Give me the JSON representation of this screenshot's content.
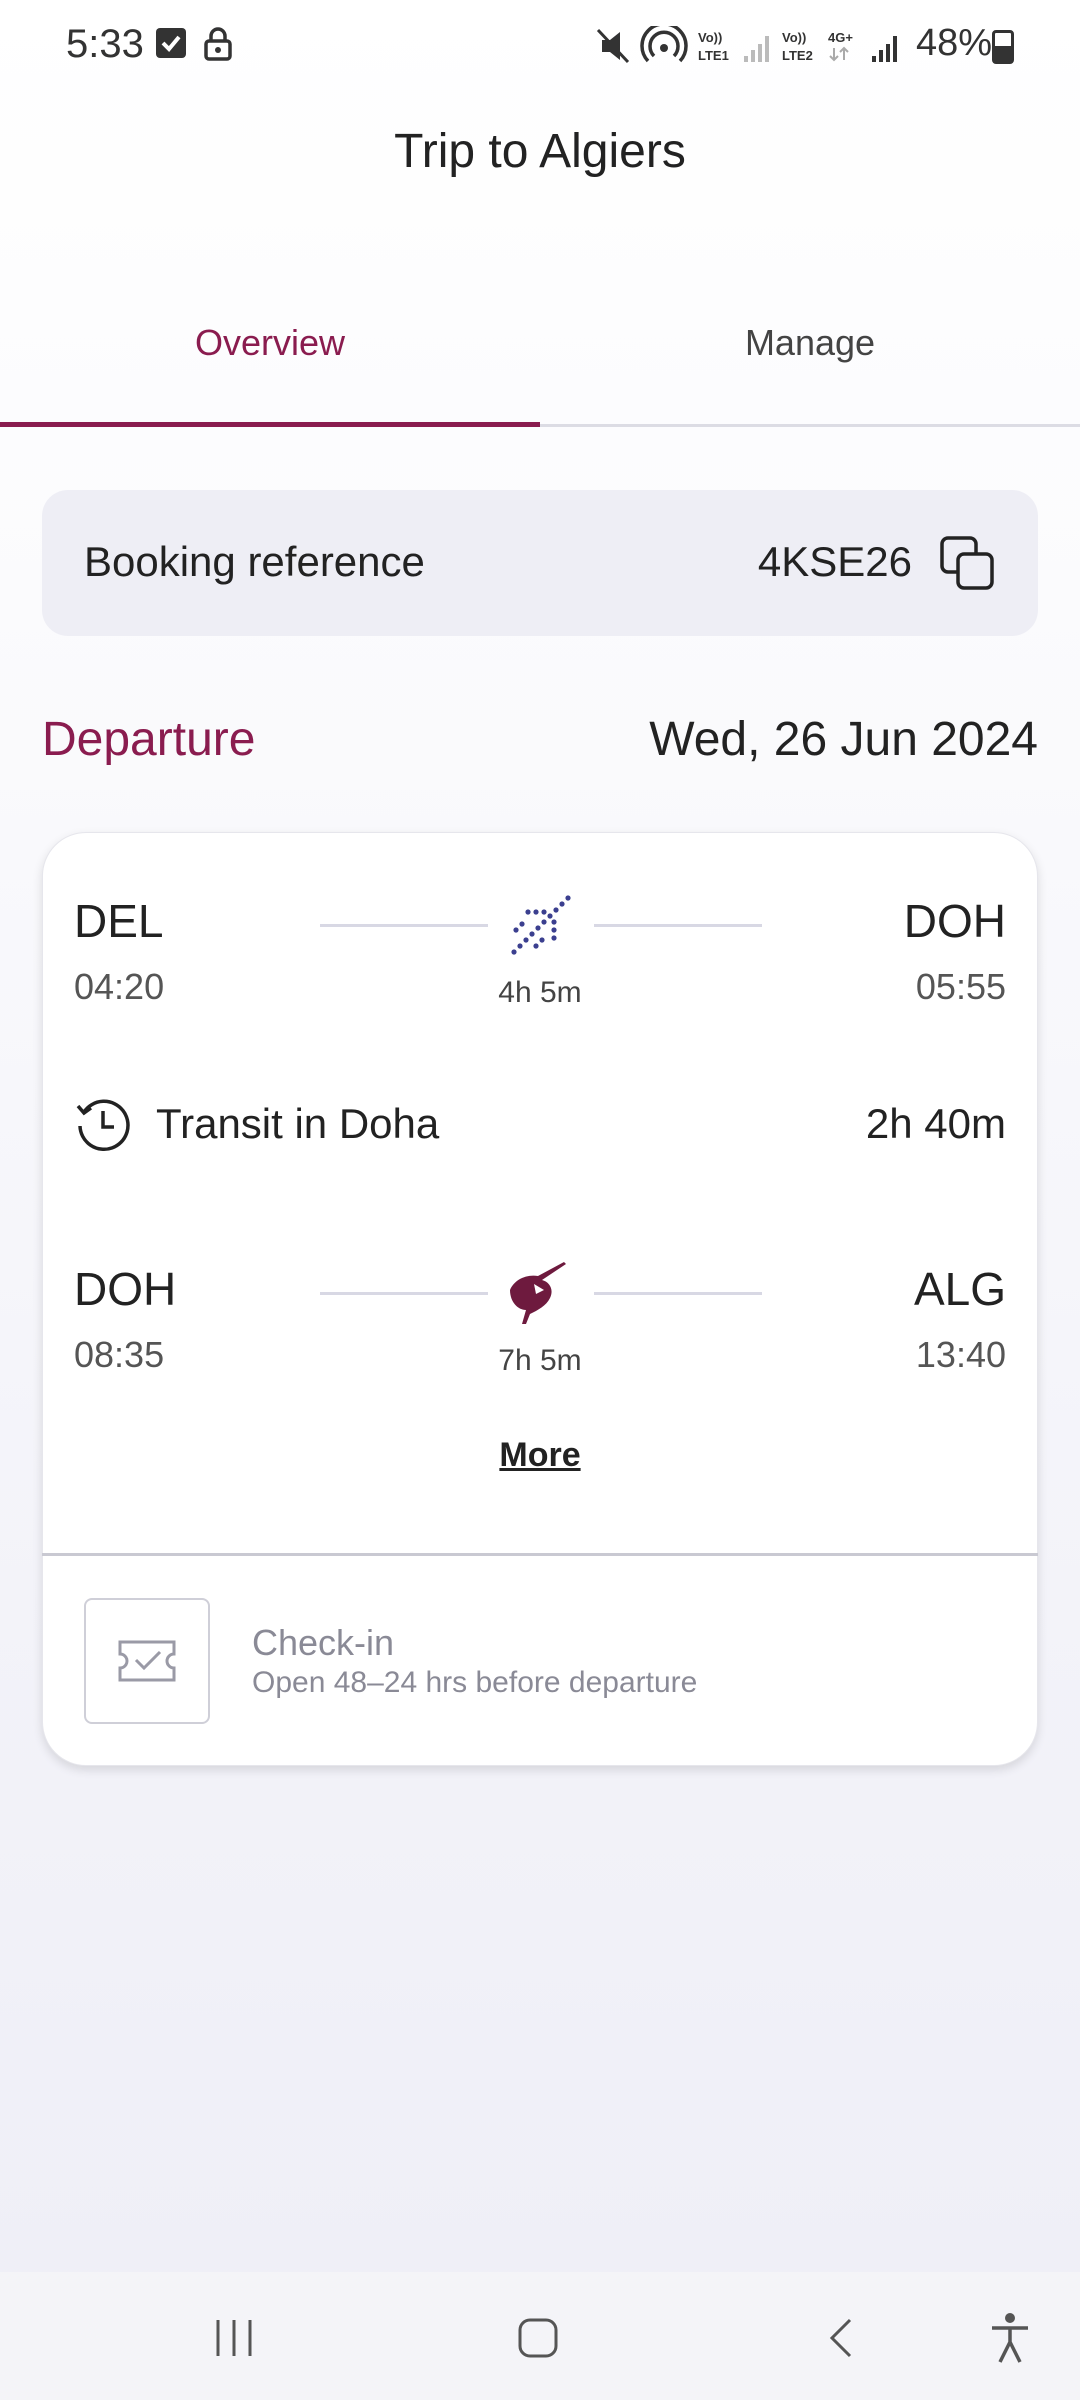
{
  "status_bar": {
    "time": "5:33",
    "battery": "48%",
    "icons": [
      "checkbox-icon",
      "lock-icon",
      "mute-icon",
      "hotspot-icon",
      "volte-lte1-icon",
      "signal-icon",
      "volte-lte2-icon",
      "4g-plus-icon",
      "signal-icon",
      "battery-icon"
    ],
    "network_labels": {
      "volte1": "Vo)) LTE1",
      "volte2": "Vo)) LTE2",
      "net_4g": "4G+"
    }
  },
  "header": {
    "title": "Trip to Algiers"
  },
  "tabs": [
    {
      "label": "Overview",
      "active": true
    },
    {
      "label": "Manage",
      "active": false
    }
  ],
  "booking": {
    "label": "Booking reference",
    "reference": "4KSE26"
  },
  "departure": {
    "label": "Departure",
    "date": "Wed, 26 Jun 2024"
  },
  "segments": [
    {
      "from": "DEL",
      "dep_time": "04:20",
      "duration": "4h 5m",
      "to": "DOH",
      "arr_time": "05:55",
      "icon": "plane-icon"
    },
    {
      "from": "DOH",
      "dep_time": "08:35",
      "duration": "7h 5m",
      "to": "ALG",
      "arr_time": "13:40",
      "icon": "oryx-logo-icon"
    }
  ],
  "transit": {
    "label": "Transit in Doha",
    "duration": "2h 40m"
  },
  "more_label": "More",
  "checkin": {
    "title": "Check-in",
    "subtitle": "Open 48–24 hrs before departure"
  },
  "colors": {
    "accent": "#8a1c4f",
    "plane_icon": "#3b3f8f",
    "line": "#d8d8e4"
  }
}
